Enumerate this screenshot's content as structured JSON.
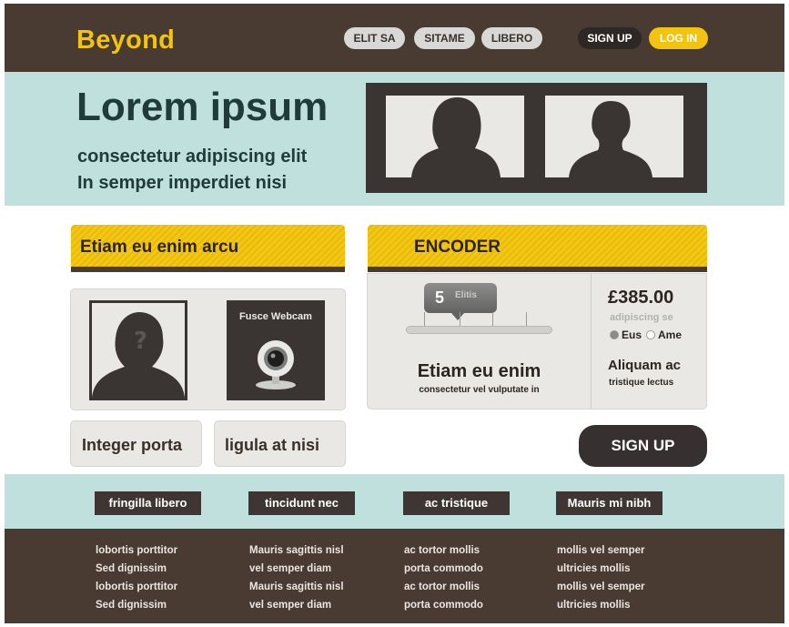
{
  "header": {
    "logo": "Beyond",
    "nav": [
      "ELIT SA",
      "SITAME",
      "LIBERO"
    ],
    "signup_label": "SIGN UP",
    "login_label": "LOG IN"
  },
  "hero": {
    "title": "Lorem ipsum",
    "subtitle_line1": "consectetur adipiscing elit",
    "subtitle_line2": "In semper imperdiet nisi"
  },
  "left": {
    "banner": "Etiam eu enim arcu",
    "webcam_label": "Fusce Webcam",
    "button1": "Integer porta",
    "button2": "ligula at nisi"
  },
  "encoder": {
    "banner": "ENCODER",
    "tooltip_value": "5",
    "tooltip_word": "Elitis",
    "main": "Etiam eu enim",
    "sub": "consectetur vel vulputate in",
    "price": "£385.00",
    "price_sub": "adipiscing se",
    "radio1": "Eus",
    "radio2": "Ame",
    "aside_main": "Aliquam ac",
    "aside_sub": "tristique lectus"
  },
  "signup_big": "SIGN UP",
  "band": [
    "fringilla libero",
    "tincidunt nec",
    "ac tristique",
    "Mauris mi nibh"
  ],
  "footer": [
    [
      "lobortis porttitor",
      "Sed dignissim",
      "lobortis porttitor",
      "Sed dignissim"
    ],
    [
      "Mauris sagittis nisl",
      "vel semper diam",
      "Mauris sagittis nisl",
      "vel semper diam"
    ],
    [
      "ac tortor mollis",
      "porta commodo",
      "ac tortor mollis",
      "porta commodo"
    ],
    [
      "mollis vel semper",
      "ultricies mollis",
      "mollis vel semper",
      "ultricies mollis"
    ]
  ],
  "colors": {
    "brown": "#4a3b32",
    "yellow": "#f2c40f",
    "aqua": "#bfe0dd",
    "dark": "#363130"
  },
  "icons": [
    "person-silhouette-female-icon",
    "person-silhouette-male-icon",
    "unknown-user-icon",
    "webcam-icon"
  ]
}
